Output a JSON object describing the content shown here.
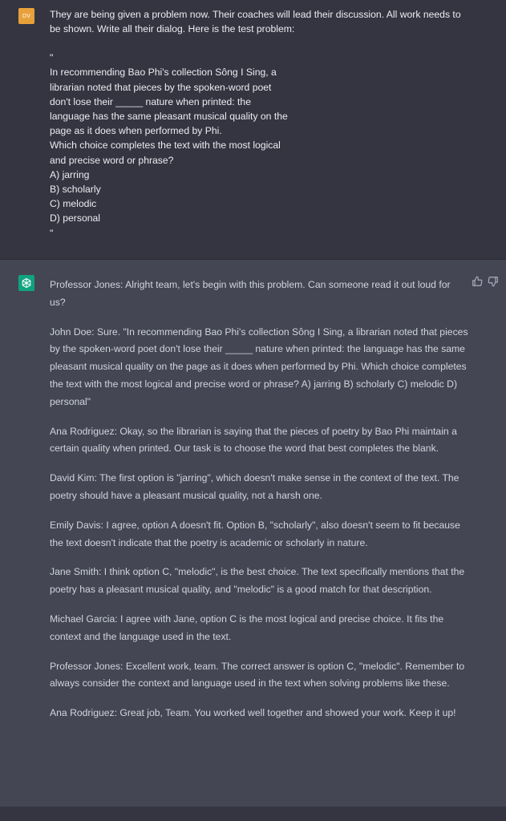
{
  "user_message": {
    "avatar_initials": "DV",
    "intro": "They are being given a problem now. Their coaches will lead their discussion. All work needs to be shown. Write all their dialog. Here is the test problem:",
    "open_quote": "\"",
    "problem_lines": [
      "In recommending Bao Phi's collection Sông I Sing, a",
      "librarian noted that pieces by the spoken-word poet",
      "don't lose their _____ nature when printed: the",
      "language has the same pleasant musical quality on the",
      "page as it does when performed by Phi.",
      "Which choice completes the text with the most logical",
      "and precise word or phrase?",
      "A) jarring",
      "B) scholarly",
      "C) melodic",
      "D) personal"
    ],
    "close_quote": "\""
  },
  "assistant_message": {
    "paragraphs": [
      "Professor Jones: Alright team, let's begin with this problem. Can someone read it out loud for us?",
      "John Doe: Sure. \"In recommending Bao Phi's collection Sông I Sing, a librarian noted that pieces by the spoken-word poet don't lose their _____ nature when printed: the language has the same pleasant musical quality on the page as it does when performed by Phi. Which choice completes the text with the most logical and precise word or phrase? A) jarring B) scholarly C) melodic D) personal\"",
      "Ana Rodriguez: Okay, so the librarian is saying that the pieces of poetry by Bao Phi maintain a certain quality when printed. Our task is to choose the word that best completes the blank.",
      "David Kim: The first option is \"jarring\", which doesn't make sense in the context of the text. The poetry should have a pleasant musical quality, not a harsh one.",
      "Emily Davis: I agree, option A doesn't fit. Option B, \"scholarly\", also doesn't seem to fit because the text doesn't indicate that the poetry is academic or scholarly in nature.",
      "Jane Smith: I think option C, \"melodic\", is the best choice. The text specifically mentions that the poetry has a pleasant musical quality, and \"melodic\" is a good match for that description.",
      "Michael Garcia: I agree with Jane, option C is the most logical and precise choice. It fits the context and the language used in the text.",
      "Professor Jones: Excellent work, team. The correct answer is option C, \"melodic\". Remember to always consider the context and language used in the text when solving problems like these.",
      "Ana Rodriguez: Great job, Team. You worked well together and showed your work. Keep it up!"
    ],
    "feedback_icons": [
      "thumbs-up-icon",
      "thumbs-down-icon"
    ]
  },
  "colors": {
    "user_bg": "#343541",
    "assistant_bg": "#444654",
    "user_avatar": "#e8a13a",
    "assistant_avatar": "#10a37f"
  }
}
